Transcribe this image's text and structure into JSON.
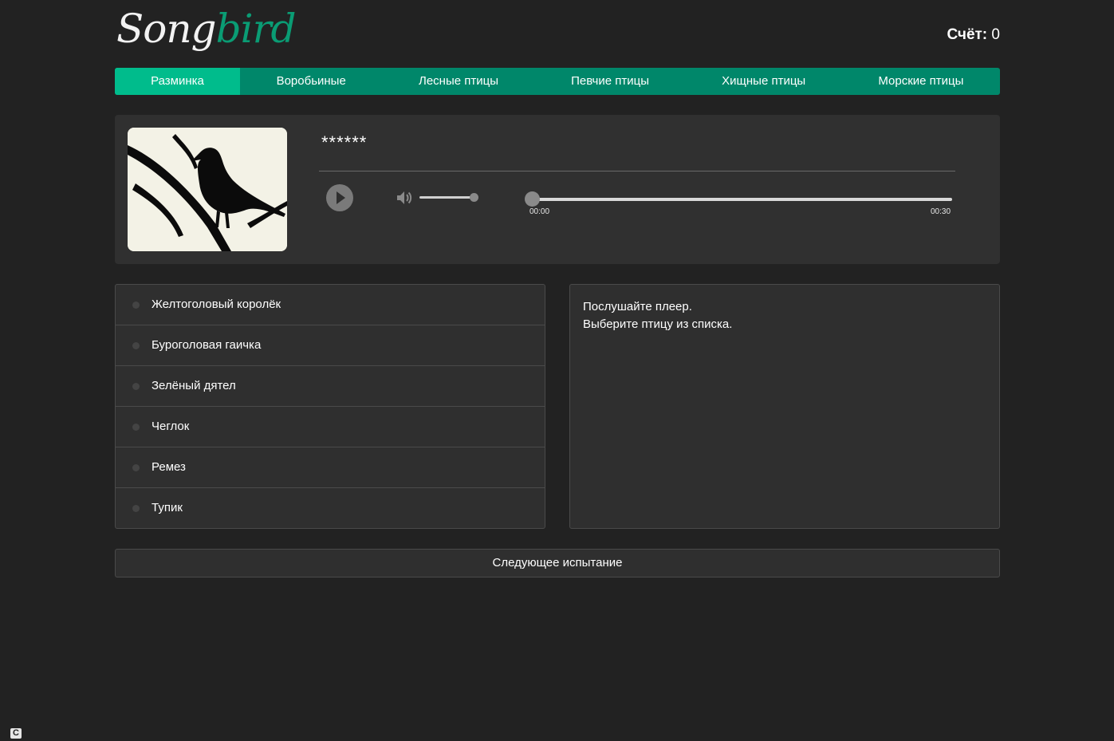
{
  "header": {
    "logo_part1": "Song",
    "logo_part2": "bird",
    "score_label": "Счёт:",
    "score_value": "0"
  },
  "nav": {
    "items": [
      {
        "label": "Разминка",
        "active": true
      },
      {
        "label": "Воробьиные",
        "active": false
      },
      {
        "label": "Лесные птицы",
        "active": false
      },
      {
        "label": "Певчие птицы",
        "active": false
      },
      {
        "label": "Хищные птицы",
        "active": false
      },
      {
        "label": "Морские птицы",
        "active": false
      }
    ]
  },
  "player": {
    "bird_name": "******",
    "image_icon": "bird-silhouette-icon",
    "time_current": "00:00",
    "time_total": "00:30",
    "volume_fraction": 1.0,
    "progress_fraction": 0.0
  },
  "answers": [
    "Желтоголовый королёк",
    "Буроголовая гаичка",
    "Зелёный дятел",
    "Чеглок",
    "Ремез",
    "Тупик"
  ],
  "info": {
    "line1": "Послушайте плеер.",
    "line2": "Выберите птицу из списка."
  },
  "next_button": {
    "label": "Следующее испытание"
  },
  "colors": {
    "background": "#222222",
    "accent": "#00bc8c",
    "nav": "#00876a",
    "card": "#303030"
  }
}
